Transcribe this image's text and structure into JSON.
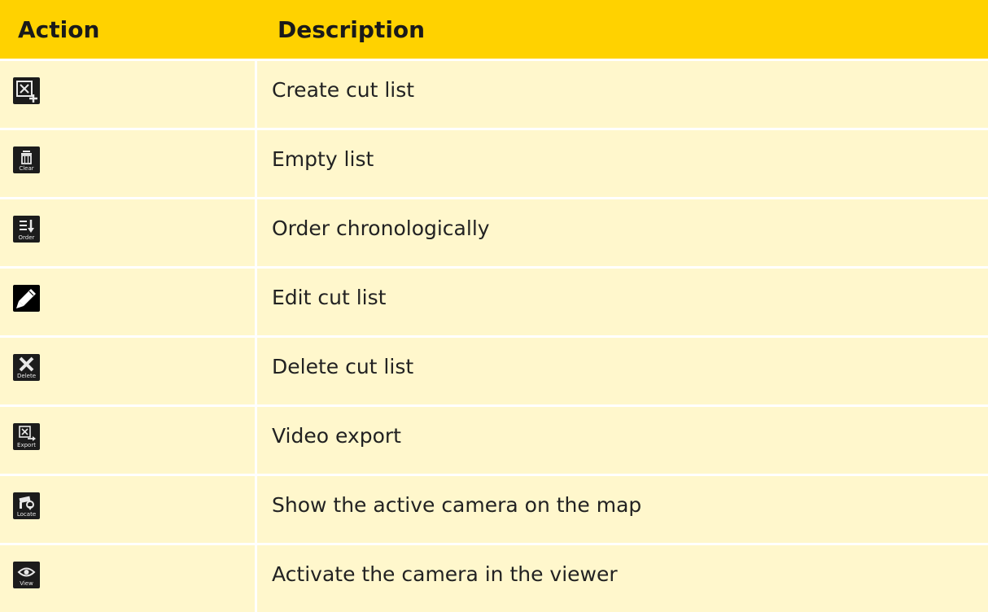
{
  "header": {
    "action": "Action",
    "description": "Description"
  },
  "rows": [
    {
      "icon": "create-cut-list-icon",
      "caption": "",
      "description": "Create cut list"
    },
    {
      "icon": "clear-icon",
      "caption": "Clear",
      "description": "Empty list"
    },
    {
      "icon": "order-icon",
      "caption": "Order",
      "description": "Order chronologically"
    },
    {
      "icon": "edit-icon",
      "caption": "",
      "description": "Edit cut list"
    },
    {
      "icon": "delete-icon",
      "caption": "Delete",
      "description": "Delete cut list"
    },
    {
      "icon": "export-icon",
      "caption": "Export",
      "description": "Video export"
    },
    {
      "icon": "locate-icon",
      "caption": "Locate",
      "description": "Show the active camera on the map"
    },
    {
      "icon": "view-icon",
      "caption": "View",
      "description": "Activate the camera in the viewer"
    }
  ],
  "colors": {
    "header_bg": "#ffd200",
    "row_bg": "#fff7cc",
    "icon_bg": "#1c1c1c"
  }
}
